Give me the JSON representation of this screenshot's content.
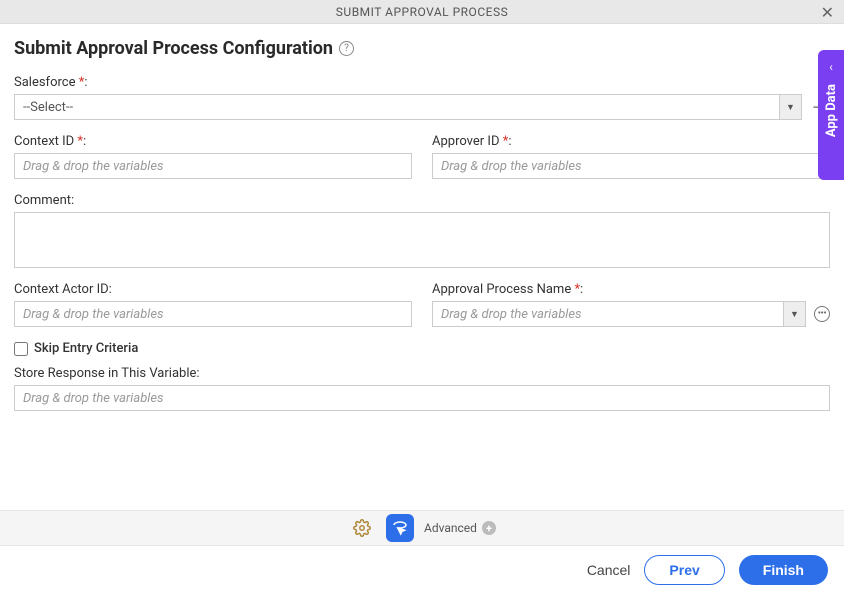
{
  "modal": {
    "title": "SUBMIT APPROVAL PROCESS"
  },
  "page": {
    "heading": "Submit Approval Process Configuration"
  },
  "fields": {
    "salesforce": {
      "label": "Salesforce ",
      "selected": "--Select--"
    },
    "context_id": {
      "label": "Context ID ",
      "placeholder": "Drag & drop the variables"
    },
    "approver_id": {
      "label": "Approver ID ",
      "placeholder": "Drag & drop the variables"
    },
    "comment": {
      "label": "Comment:"
    },
    "context_actor_id": {
      "label": "Context Actor ID:",
      "placeholder": "Drag & drop the variables"
    },
    "approval_process_name": {
      "label": "Approval Process Name ",
      "placeholder": "Drag & drop the variables"
    },
    "skip_entry": {
      "label": "Skip Entry Criteria"
    },
    "store_response": {
      "label": "Store Response in This Variable:",
      "placeholder": "Drag & drop the variables"
    },
    "required_marker": "*",
    "colon": ":"
  },
  "toolbar": {
    "advanced_label": "Advanced"
  },
  "footer": {
    "cancel": "Cancel",
    "prev": "Prev",
    "finish": "Finish"
  },
  "side_tab": {
    "label": "App Data"
  }
}
